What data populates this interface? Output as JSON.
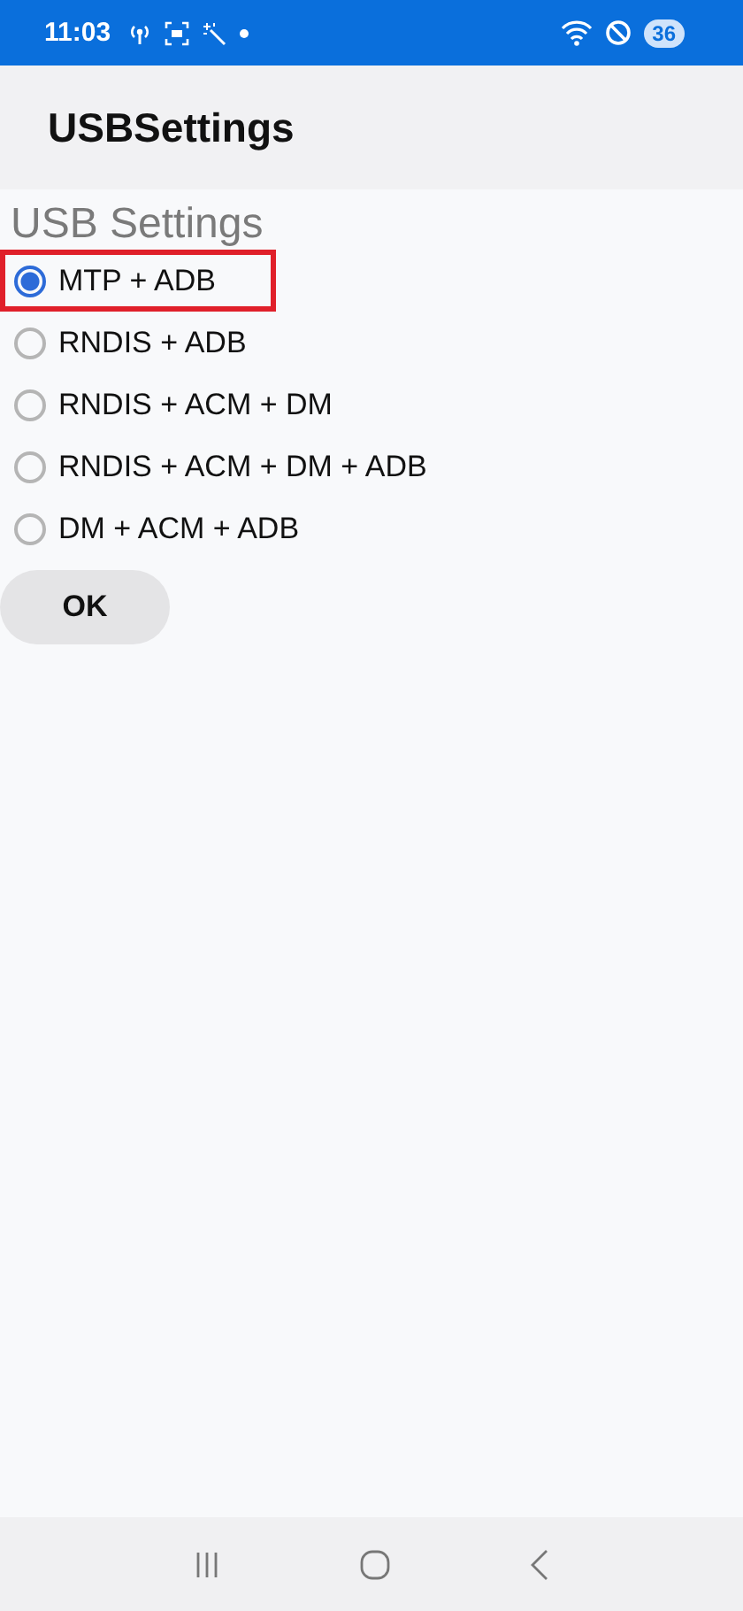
{
  "status_bar": {
    "time": "11:03",
    "battery": "36"
  },
  "app_bar": {
    "title": "USBSettings"
  },
  "section": {
    "title": "USB Settings"
  },
  "options": [
    {
      "label": "MTP + ADB",
      "selected": true,
      "highlighted": true
    },
    {
      "label": "RNDIS + ADB",
      "selected": false,
      "highlighted": false
    },
    {
      "label": "RNDIS + ACM + DM",
      "selected": false,
      "highlighted": false
    },
    {
      "label": "RNDIS + ACM + DM + ADB",
      "selected": false,
      "highlighted": false
    },
    {
      "label": "DM + ACM + ADB",
      "selected": false,
      "highlighted": false
    }
  ],
  "buttons": [
    {
      "label": "OK"
    }
  ]
}
